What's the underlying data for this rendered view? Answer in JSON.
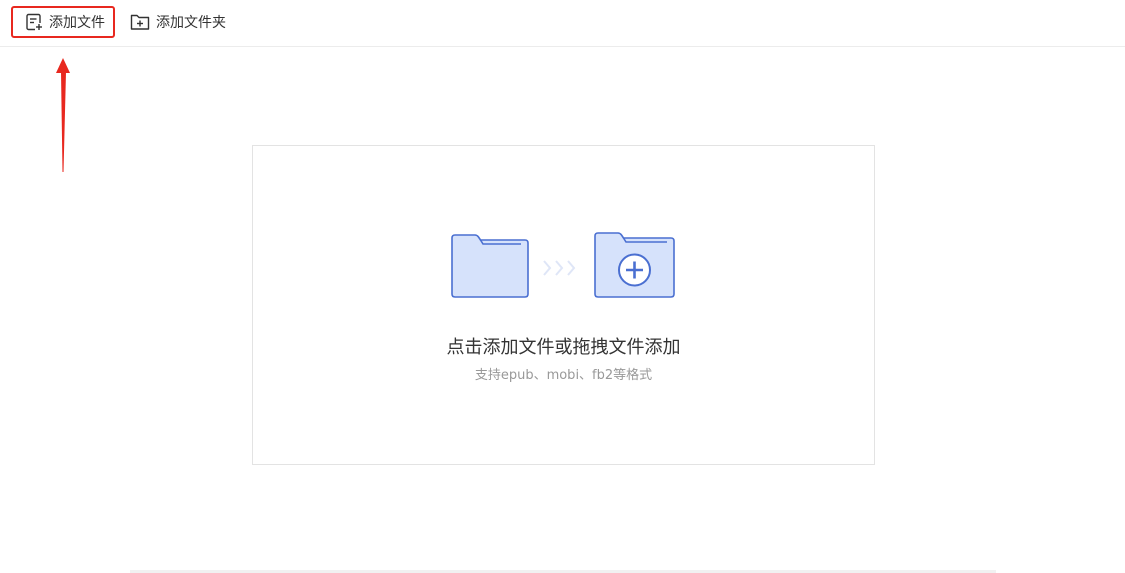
{
  "toolbar": {
    "add_file_label": "添加文件",
    "add_folder_label": "添加文件夹"
  },
  "drop_zone": {
    "title": "点击添加文件或拖拽文件添加",
    "subtitle": "支持epub、mobi、fb2等格式"
  },
  "colors": {
    "highlight_border": "#e8281f",
    "folder_fill": "#d6e2fb",
    "folder_stroke": "#4a6fd1",
    "chevron": "#dfe6f7"
  }
}
